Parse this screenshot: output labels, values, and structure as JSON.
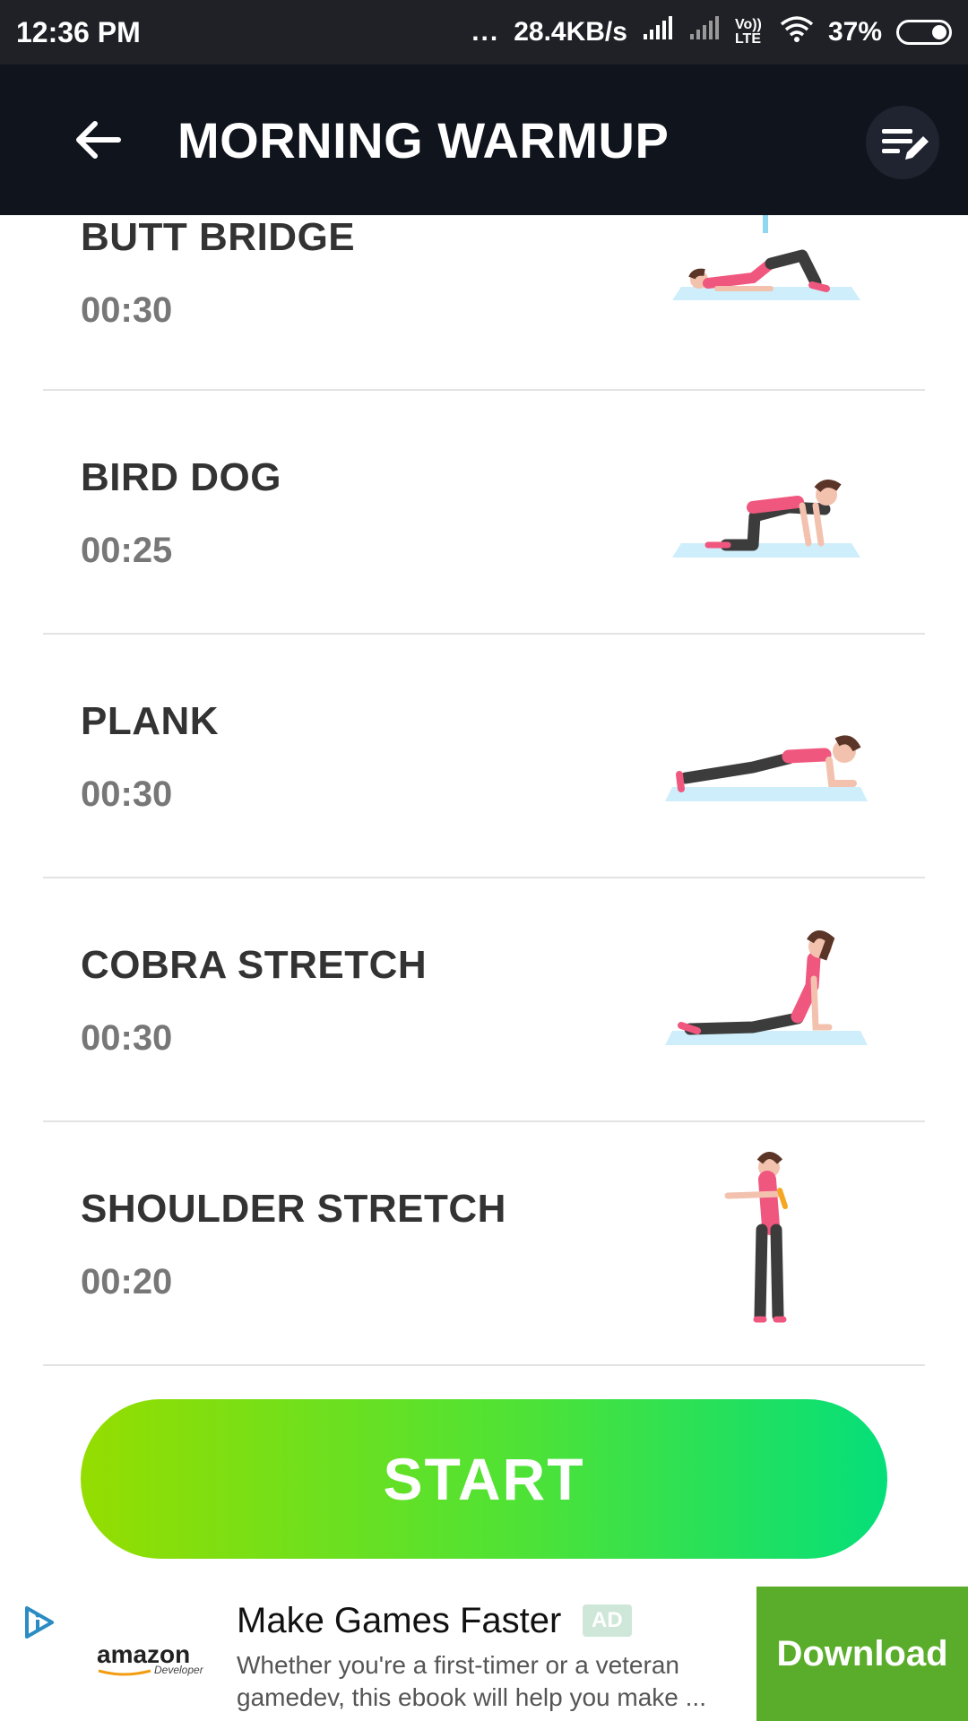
{
  "status_bar": {
    "time": "12:36 PM",
    "dots": "...",
    "network_speed": "28.4KB/s",
    "volte": "Vo)) LTE",
    "battery": "37%"
  },
  "app_bar": {
    "title": "MORNING WARMUP",
    "back_icon": "arrow-left-icon",
    "edit_icon": "list-edit-icon"
  },
  "exercises": [
    {
      "name": "BUTT BRIDGE",
      "duration": "00:30",
      "image": "butt-bridge-illustration"
    },
    {
      "name": "BIRD DOG",
      "duration": "00:25",
      "image": "bird-dog-illustration"
    },
    {
      "name": "PLANK",
      "duration": "00:30",
      "image": "plank-illustration"
    },
    {
      "name": "COBRA STRETCH",
      "duration": "00:30",
      "image": "cobra-stretch-illustration"
    },
    {
      "name": "SHOULDER STRETCH",
      "duration": "00:20",
      "image": "shoulder-stretch-illustration"
    }
  ],
  "start_button": {
    "label": "START"
  },
  "ad": {
    "advertiser": "amazon",
    "advertiser_sub": "Developer",
    "title": "Make Games Faster",
    "badge": "AD",
    "description_line1": "Whether you're a first-timer or a veteran",
    "description_line2": "gamedev, this ebook will help you make ...",
    "cta": "Download"
  },
  "colors": {
    "app_bar_bg": "#10141c",
    "start_gradient_start": "#95dd00",
    "start_gradient_end": "#05df7a",
    "ad_cta_bg": "#5aad2a",
    "accent_pink": "#f0577e",
    "mat_blue": "#cfeefb"
  }
}
